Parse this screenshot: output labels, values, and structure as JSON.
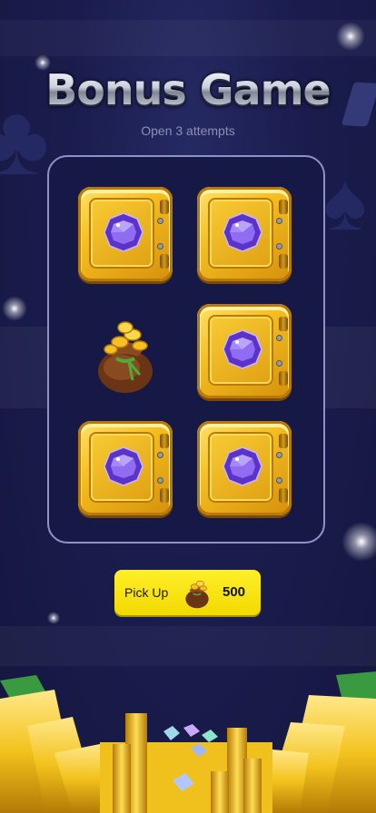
{
  "title": "Bonus Game",
  "subtitle": "Open 3 attempts",
  "grid": [
    {
      "type": "safe",
      "icon": "gem-icon"
    },
    {
      "type": "safe",
      "icon": "gem-icon"
    },
    {
      "type": "opened",
      "icon": "money-bag-icon"
    },
    {
      "type": "safe",
      "icon": "gem-icon"
    },
    {
      "type": "safe",
      "icon": "gem-icon"
    },
    {
      "type": "safe",
      "icon": "gem-icon"
    }
  ],
  "pickup": {
    "label": "Pick Up",
    "value": "500",
    "icon": "money-bag-icon"
  },
  "colors": {
    "background": "#1a1c4d",
    "board_border": "#8e93c6",
    "safe_gold": "#f5bd1f",
    "gem_purple": "#7b52e6",
    "pickup_yellow": "#f2d900"
  }
}
